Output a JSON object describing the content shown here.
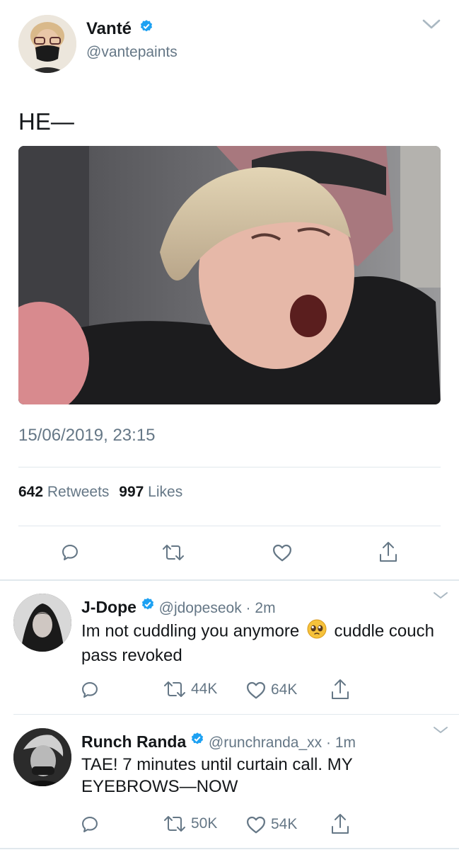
{
  "main_tweet": {
    "author_name": "Vanté",
    "author_handle": "@vantepaints",
    "text": "HE—",
    "timestamp": "15/06/2019, 23:15",
    "retweets_count": "642",
    "retweets_label": "Retweets",
    "likes_count": "997",
    "likes_label": "Likes"
  },
  "replies": [
    {
      "author_name": "J-Dope",
      "author_handle": "@jdopeseok",
      "separator": "·",
      "time": "2m",
      "text_part1": "Im not cuddling you anymore",
      "emoji": "🥺",
      "text_part2": "cuddle couch pass revoked",
      "retweets": "44K",
      "likes": "64K"
    },
    {
      "author_name": "Runch Randa",
      "author_handle": "@runchranda_xx",
      "separator": "·",
      "time": "1m",
      "text": "TAE! 7 minutes until curtain call. MY EYEBROWS—NOW",
      "retweets": "50K",
      "likes": "54K"
    }
  ],
  "colors": {
    "verified_blue": "#1da1f2",
    "secondary_text": "#657786",
    "divider": "#e1e8ed"
  }
}
